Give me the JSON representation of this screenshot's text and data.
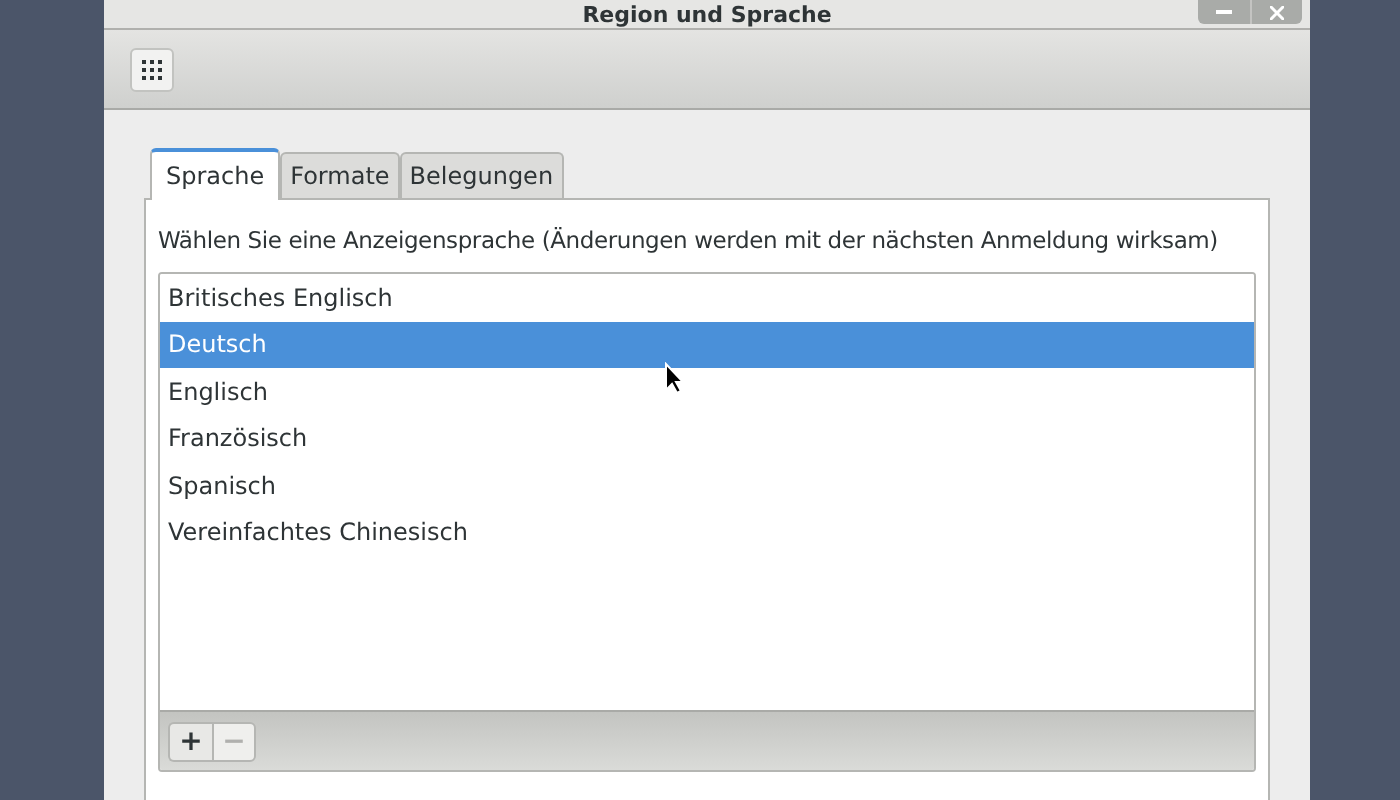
{
  "window": {
    "title": "Region und Sprache"
  },
  "tabs": [
    {
      "label": "Sprache",
      "selected": true
    },
    {
      "label": "Formate",
      "selected": false
    },
    {
      "label": "Belegungen",
      "selected": false
    }
  ],
  "description": "Wählen Sie eine Anzeigensprache (Änderungen werden mit der nächsten Anmeldung wirksam)",
  "languages": [
    {
      "name": "Britisches Englisch",
      "selected": false
    },
    {
      "name": "Deutsch",
      "selected": true
    },
    {
      "name": "Englisch",
      "selected": false
    },
    {
      "name": "Französisch",
      "selected": false
    },
    {
      "name": "Spanisch",
      "selected": false
    },
    {
      "name": "Vereinfachtes Chinesisch",
      "selected": false
    }
  ],
  "list_buttons": [
    {
      "kind": "add",
      "label": "+",
      "disabled": false
    },
    {
      "kind": "remove",
      "label": "−",
      "disabled": true
    }
  ]
}
